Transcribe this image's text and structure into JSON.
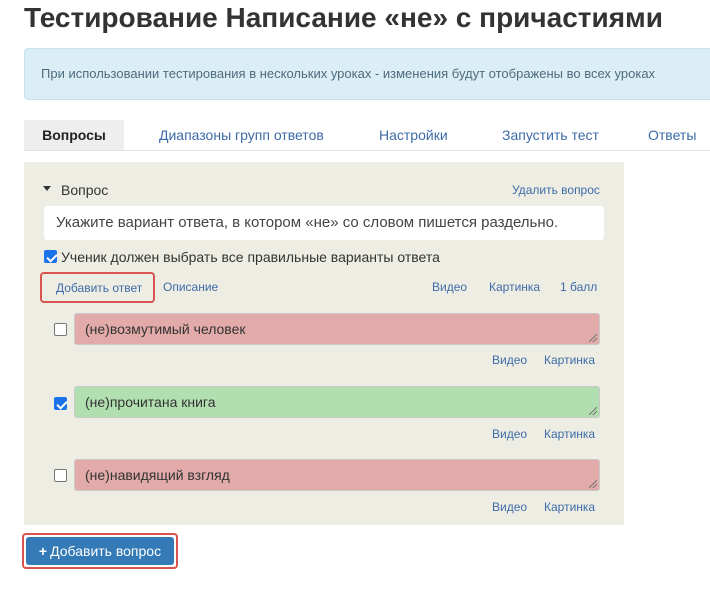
{
  "page": {
    "title": "Тестирование Написание «не» с причастиями"
  },
  "info": {
    "text": "При использовании тестирования в нескольких уроках - изменения будут отображены во всех уроках"
  },
  "tabs": [
    {
      "label": "Вопросы",
      "active": true
    },
    {
      "label": "Диапазоны групп ответов",
      "active": false
    },
    {
      "label": "Настройки",
      "active": false
    },
    {
      "label": "Запустить тест",
      "active": false
    },
    {
      "label": "Ответы",
      "active": false
    }
  ],
  "question": {
    "label": "Вопрос",
    "delete_label": "Удалить вопрос",
    "text": "Укажите вариант ответа, в котором «не» со словом пишется раздельно.",
    "must_select_all_label": "Ученик должен выбрать все правильные варианты ответа",
    "must_select_all_checked": true,
    "add_answer_label": "Добавить ответ",
    "description_label": "Описание",
    "video_label": "Видео",
    "image_label": "Картинка",
    "points_label": "1 балл"
  },
  "answers": [
    {
      "text": "(не)возмутимый человек",
      "checked": false,
      "status": "wrong",
      "video_label": "Видео",
      "image_label": "Картинка"
    },
    {
      "text": "(не)прочитана книга",
      "checked": true,
      "status": "correct",
      "video_label": "Видео",
      "image_label": "Картинка"
    },
    {
      "text": "(не)навидящий взгляд",
      "checked": false,
      "status": "wrong",
      "video_label": "Видео",
      "image_label": "Картинка"
    }
  ],
  "footer": {
    "add_question_label": "Добавить вопрос",
    "add_question_icon": "plus-icon"
  },
  "colors": {
    "info_bg": "#dbeef6",
    "panel_bg": "#eeede4",
    "wrong_answer": "#e2aaa9",
    "correct_answer": "#b2dfb0",
    "link": "#3d6ba8",
    "primary_button": "#337ab7",
    "highlight_border": "#d9534f"
  }
}
